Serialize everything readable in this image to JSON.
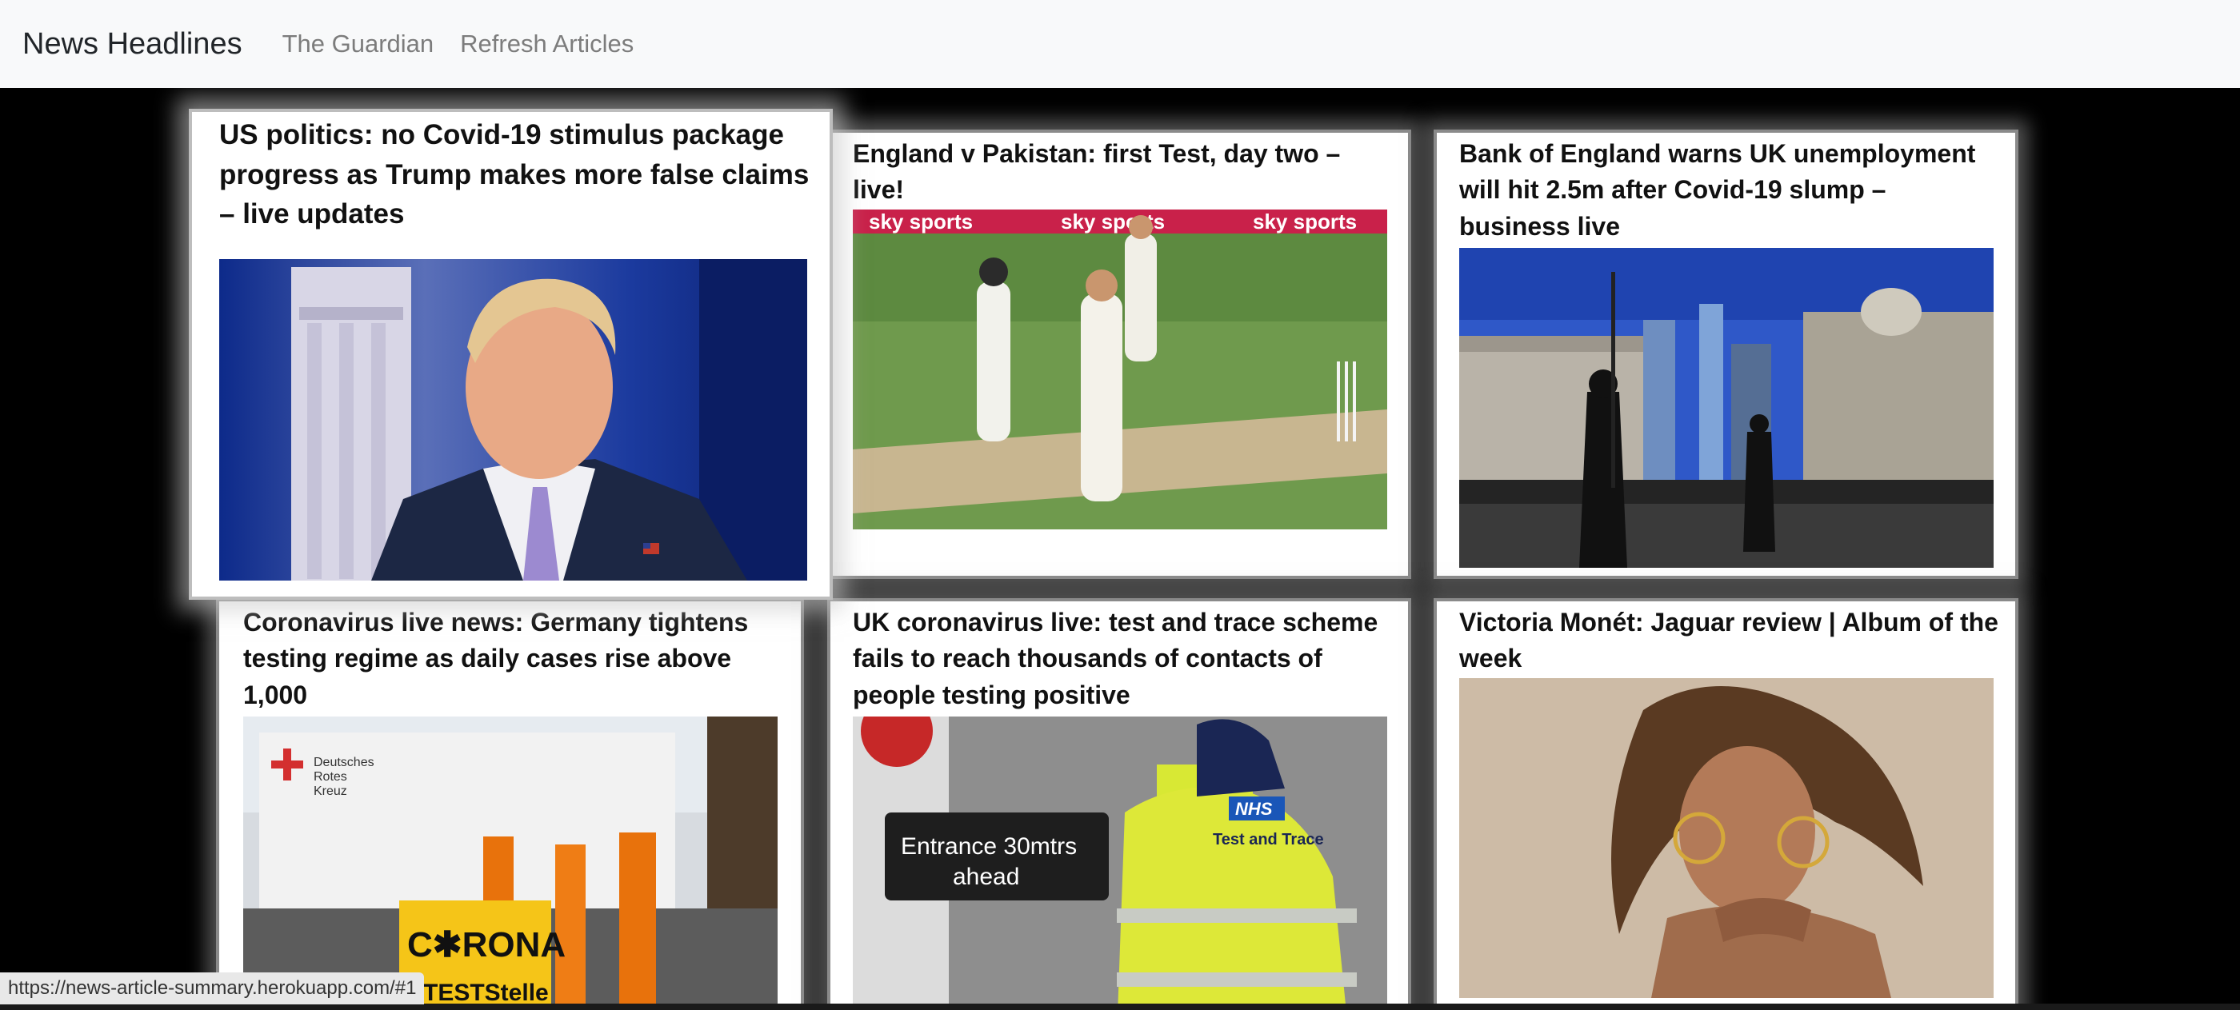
{
  "navbar": {
    "brand": "News Headlines",
    "links": [
      {
        "label": "The Guardian"
      },
      {
        "label": "Refresh Articles"
      }
    ]
  },
  "articles": [
    {
      "title": "US politics: no Covid-19 stimulus package progress as Trump makes more false claims – live updates",
      "image": "portrait of a man in a dark suit with a lilac tie in front of white columns"
    },
    {
      "title": "England v Pakistan: first Test, day two – live!",
      "image": "cricket players on a green pitch celebrating a wicket"
    },
    {
      "title": "Bank of England warns UK unemployment will hit 2.5m after Covid-19 slump – business live",
      "image": "Bank of England building with city towers and pedestrians in shadow"
    },
    {
      "title": "Coronavirus live news: Germany tightens testing regime as daily cases rise above 1,000",
      "image": "Red Cross corona test station with people in orange vests"
    },
    {
      "title": "UK coronavirus live: test and trace scheme fails to reach thousands of contacts of people testing positive",
      "image": "NHS Test and Trace worker next to sign"
    },
    {
      "title": "Victoria Monét: Jaguar review | Album of the week",
      "image": "portrait of a woman with curly hair and hoop earrings"
    }
  ],
  "image_text": {
    "redcross_line1": "Deutsches",
    "redcross_line2": "Rotes",
    "redcross_line3": "Kreuz",
    "corona_sign_line1": "C✱RONA",
    "corona_sign_line2": "TESTStelle",
    "entrance_sign_line1": "Entrance 30mtrs",
    "entrance_sign_line2": "ahead",
    "nhs_logo": "NHS",
    "nhs_vest_text_line1": "Test and Trace",
    "banner_text": "sky sports"
  },
  "status_url": "https://news-article-summary.herokuapp.com/#1",
  "colors": {
    "navbar_bg": "#f8f9fa",
    "page_bg": "#000000",
    "nav_link": "#7c7c7c",
    "brand": "#212529"
  }
}
